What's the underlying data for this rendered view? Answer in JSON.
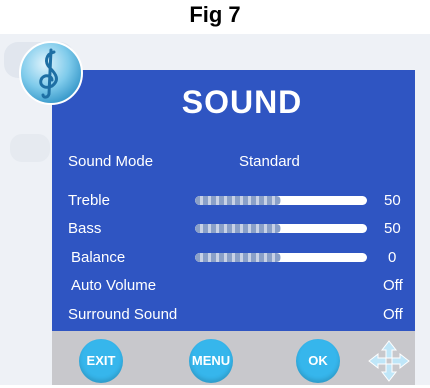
{
  "caption": "Fig 7",
  "menu": {
    "title": "SOUND",
    "sound_mode": {
      "label": "Sound Mode",
      "value": "Standard"
    },
    "treble": {
      "label": "Treble",
      "value": "50",
      "level": 0.5
    },
    "bass": {
      "label": "Bass",
      "value": "50",
      "level": 0.5
    },
    "balance": {
      "label": "Balance",
      "value": "0",
      "level": 0.5
    },
    "auto_volume": {
      "label": "Auto Volume",
      "value": "Off"
    },
    "surround_sound": {
      "label": "Surround Sound",
      "value": "Off"
    }
  },
  "buttons": {
    "exit": "EXIT",
    "menu": "MENU",
    "ok": "OK"
  },
  "colors": {
    "panel": "#2f55c2",
    "button": "#36b6ec",
    "bar": "#c8c8cc"
  },
  "icons": {
    "logo": "music-note-icon",
    "navigation": "four-way-arrows-icon"
  }
}
